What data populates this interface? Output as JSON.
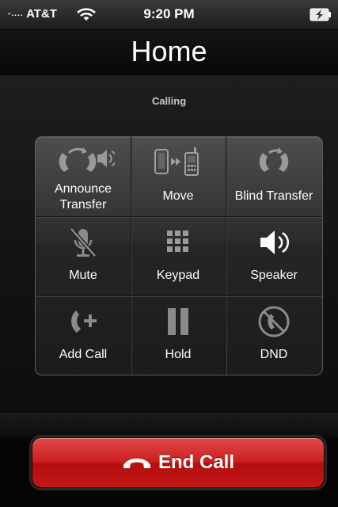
{
  "status_bar": {
    "signal_dots": "-....",
    "carrier": "AT&T",
    "time": "9:20 PM",
    "wifi_icon": "wifi-icon",
    "battery_icon": "battery-charging-icon"
  },
  "header": {
    "title": "Home"
  },
  "call": {
    "status": "Calling"
  },
  "actions": [
    {
      "label_line1": "Announce",
      "label_line2": "Transfer",
      "icon": "announce-transfer-icon"
    },
    {
      "label": "Move",
      "icon": "move-call-icon"
    },
    {
      "label": "Blind Transfer",
      "icon": "blind-transfer-icon"
    },
    {
      "label": "Mute",
      "icon": "mute-microphone-icon"
    },
    {
      "label": "Keypad",
      "icon": "keypad-icon"
    },
    {
      "label": "Speaker",
      "icon": "speaker-icon"
    },
    {
      "label": "Add Call",
      "icon": "add-call-icon"
    },
    {
      "label": "Hold",
      "icon": "hold-icon"
    },
    {
      "label": "DND",
      "icon": "do-not-disturb-icon"
    }
  ],
  "end_call": {
    "label": "End Call",
    "icon": "hang-up-icon",
    "color": "#cc1f1f"
  }
}
